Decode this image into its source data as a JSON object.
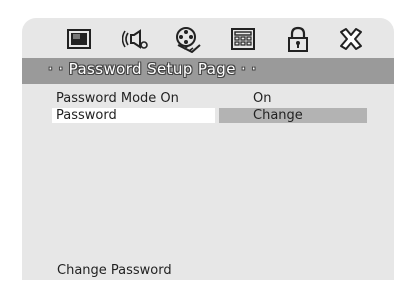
{
  "icons": [
    "monitor-icon",
    "speaker-audio-icon",
    "film-reel-icon",
    "keypad-icon",
    "padlock-icon",
    "exit-x-icon"
  ],
  "header": {
    "title": "· · Password Setup Page · ·"
  },
  "rows": [
    {
      "label": "Password Mode On",
      "value": "On"
    },
    {
      "label": "Password",
      "value": "Change"
    }
  ],
  "footer": {
    "hint": "Change Password"
  },
  "colors": {
    "panel": "#e7e7e7",
    "header": "#9a9a9a",
    "selected_value": "#b3b3b3"
  }
}
